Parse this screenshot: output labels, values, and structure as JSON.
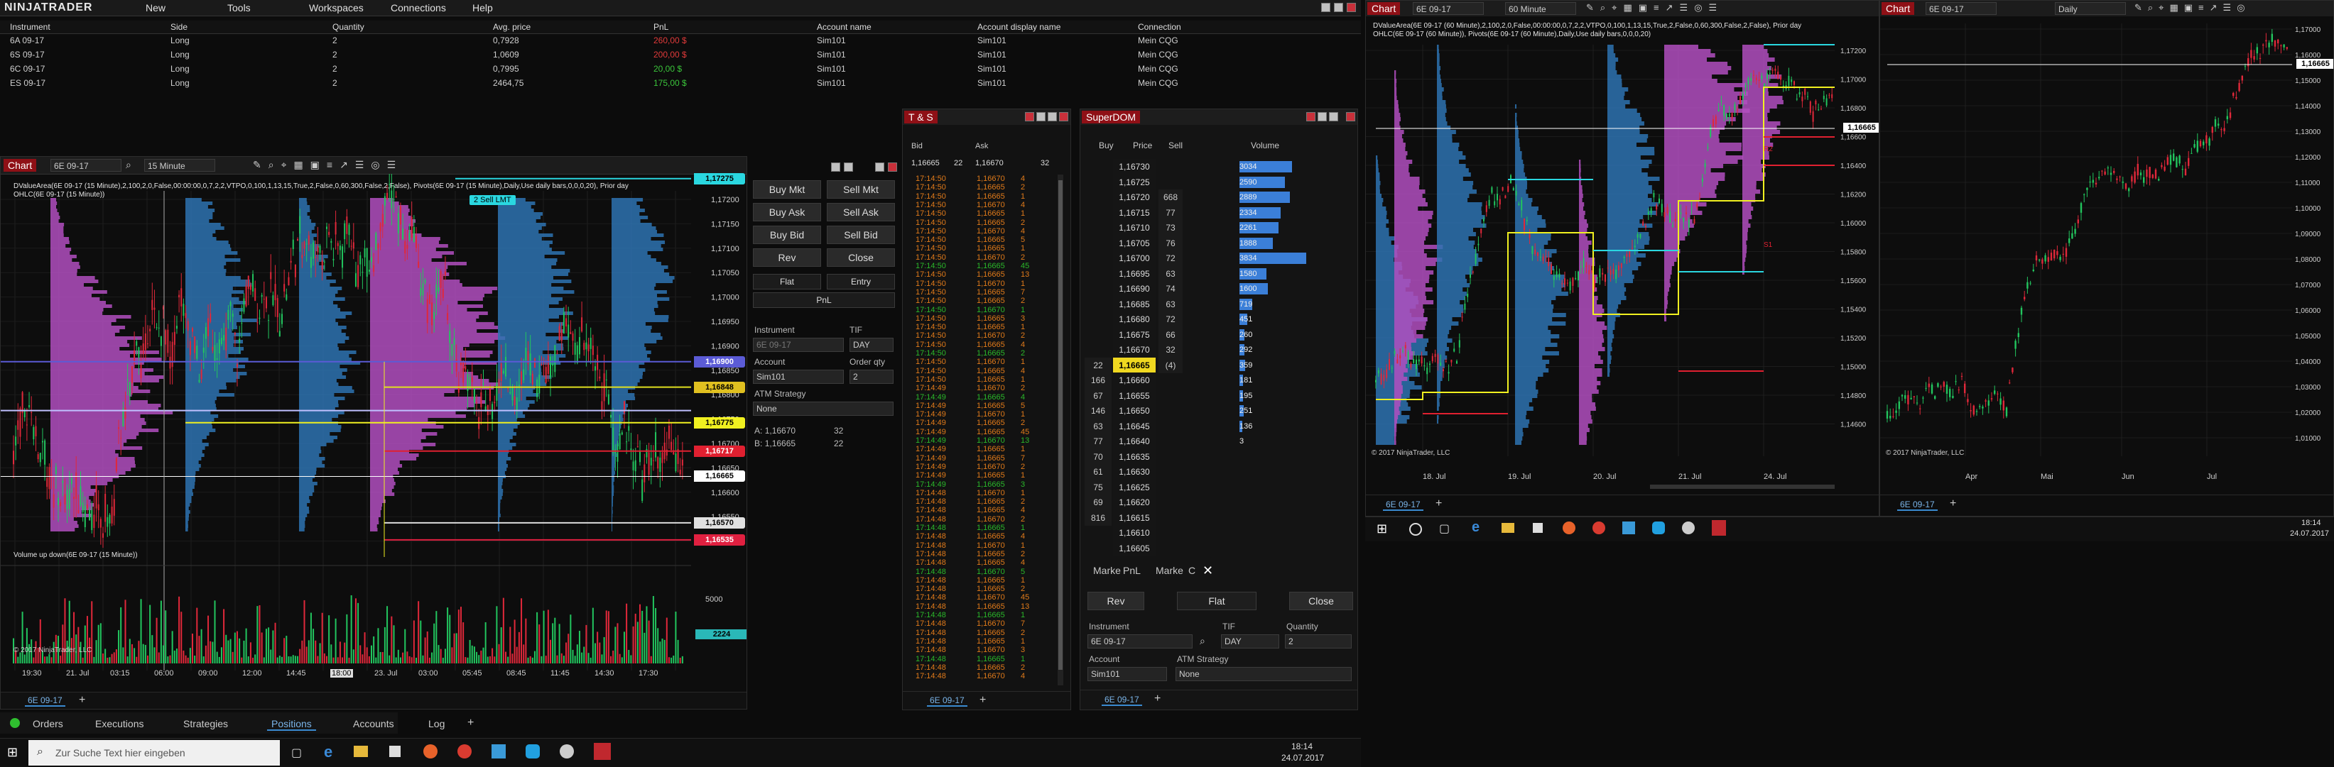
{
  "control_center": {
    "brand": "NINJATRADER",
    "menu": [
      "New",
      "Tools",
      "Workspaces",
      "Connections",
      "Help"
    ],
    "positions_headers": [
      "Instrument",
      "Side",
      "Quantity",
      "Avg. price",
      "PnL",
      "Account name",
      "Account display name",
      "Connection"
    ],
    "positions_rows": [
      {
        "instrument": "6A 09-17",
        "side": "Long",
        "qty": "2",
        "avg": "0,7928",
        "pnl": "260,00 $",
        "pnl_color": "#e03a3a",
        "account": "Sim101",
        "display": "Sim101",
        "conn": "Mein CQG"
      },
      {
        "instrument": "6S 09-17",
        "side": "Long",
        "qty": "2",
        "avg": "1,0609",
        "pnl": "200,00 $",
        "pnl_color": "#e03a3a",
        "account": "Sim101",
        "display": "Sim101",
        "conn": "Mein CQG"
      },
      {
        "instrument": "6C 09-17",
        "side": "Long",
        "qty": "2",
        "avg": "0,7995",
        "pnl": "20,00 $",
        "pnl_color": "#3ac43a",
        "account": "Sim101",
        "display": "Sim101",
        "conn": "Mein CQG"
      },
      {
        "instrument": "ES 09-17",
        "side": "Long",
        "qty": "2",
        "avg": "2464,75",
        "pnl": "175,00 $",
        "pnl_color": "#3ac43a",
        "account": "Sim101",
        "display": "Sim101",
        "conn": "Mein CQG"
      }
    ],
    "bottom_tabs": [
      "Orders",
      "Executions",
      "Strategies",
      "Positions",
      "Accounts",
      "Log"
    ],
    "active_tab": "Positions"
  },
  "chart1": {
    "title": "Chart",
    "instrument": "6E 09-17",
    "interval": "15 Minute",
    "indicator_line1": "DValueArea(6E 09-17 (15 Minute),2,100,2,0,False,00:00:00,0,7,2,2,VTPO,0,100,1,13,15,True,2,False,0,60,300,False,2,False), Pivots(6E 09-17 (15 Minute),Daily,Use daily bars,0,0,0,20), Prior day",
    "indicator_line2": "OHLC(6E 09-17 (15 Minute))",
    "sell_lmt_label": "2  Sell LMT",
    "price_labels": [
      "1,17200",
      "1,17150",
      "1,17100",
      "1,17050",
      "1,17000",
      "1,16950",
      "1,16900",
      "1,16850",
      "1,16800",
      "1,16750",
      "1,16700",
      "1,16650",
      "1,16600",
      "1,16550",
      "1,16500"
    ],
    "price_boxes": [
      {
        "text": "1,17275",
        "bg": "#2ad7e0",
        "fg": "#000"
      },
      {
        "text": "1,16900",
        "bg": "#5b5bd6",
        "fg": "#fff"
      },
      {
        "text": "1,16848",
        "bg": "#e0c020",
        "fg": "#000"
      },
      {
        "text": "1,16775",
        "bg": "#f0f020",
        "fg": "#000"
      },
      {
        "text": "1,16717",
        "bg": "#e02030",
        "fg": "#fff"
      },
      {
        "text": "1,16665",
        "bg": "#ffffff",
        "fg": "#000"
      },
      {
        "text": "1,16570",
        "bg": "#e0e0e0",
        "fg": "#000"
      },
      {
        "text": "1,16535",
        "bg": "#e02040",
        "fg": "#fff"
      }
    ],
    "volume_title": "Volume up down(6E 09-17 (15 Minute))",
    "volume_box": "2224",
    "volume_label": "5000",
    "copyright": "© 2017 NinjaTrader, LLC",
    "time_labels": [
      "19:30",
      "21. Jul",
      "03:15",
      "06:00",
      "09:00",
      "12:00",
      "14:45",
      "18:00",
      "23. Jul",
      "03:00",
      "05:45",
      "08:45",
      "11:45",
      "14:30",
      "17:30"
    ],
    "bottom_tab": "6E 09-17",
    "chart_trader": {
      "buttons": [
        "Buy Mkt",
        "Sell Mkt",
        "Buy Ask",
        "Sell Ask",
        "Buy Bid",
        "Sell Bid",
        "Rev",
        "Close",
        "Flat",
        "Entry",
        "PnL"
      ],
      "instrument_label": "Instrument",
      "instrument_value": "6E 09-17",
      "tif_label": "TIF",
      "tif_value": "DAY",
      "account_label": "Account",
      "account_value": "Sim101",
      "qty_label": "Order qty",
      "qty_value": "2",
      "atm_label": "ATM Strategy",
      "atm_value": "None",
      "ask_line_label": "A:",
      "ask_line_price": "1,16670",
      "ask_line_size": "32",
      "bid_line_label": "B:",
      "bid_line_price": "1,16665",
      "bid_line_size": "22"
    }
  },
  "ts": {
    "title": "T & S",
    "header_bid": "Bid",
    "header_ask": "Ask",
    "bid": "1,16665",
    "bid_size": "22",
    "ask": "1,16670",
    "ask_size": "32",
    "bottom_tab": "6E 09-17"
  },
  "superdom": {
    "title": "SuperDOM",
    "headers": [
      "Buy",
      "Price",
      "Sell",
      "Volume"
    ],
    "rows": [
      {
        "buy": "",
        "price": "1,16730",
        "sell": "",
        "vol": "3034",
        "w": 0.62
      },
      {
        "buy": "",
        "price": "1,16725",
        "sell": "",
        "vol": "2590",
        "w": 0.53
      },
      {
        "buy": "",
        "price": "1,16720",
        "sell": "668",
        "vol": "2889",
        "w": 0.59
      },
      {
        "buy": "",
        "price": "1,16715",
        "sell": "77",
        "vol": "2334",
        "w": 0.48
      },
      {
        "buy": "",
        "price": "1,16710",
        "sell": "73",
        "vol": "2261",
        "w": 0.46
      },
      {
        "buy": "",
        "price": "1,16705",
        "sell": "76",
        "vol": "1888",
        "w": 0.39
      },
      {
        "buy": "",
        "price": "1,16700",
        "sell": "72",
        "vol": "3834",
        "w": 0.78
      },
      {
        "buy": "",
        "price": "1,16695",
        "sell": "63",
        "vol": "1580",
        "w": 0.32
      },
      {
        "buy": "",
        "price": "1,16690",
        "sell": "74",
        "vol": "1600",
        "w": 0.33
      },
      {
        "buy": "",
        "price": "1,16685",
        "sell": "63",
        "vol": "719",
        "w": 0.15
      },
      {
        "buy": "",
        "price": "1,16680",
        "sell": "72",
        "vol": "451",
        "w": 0.09
      },
      {
        "buy": "",
        "price": "1,16675",
        "sell": "66",
        "vol": "260",
        "w": 0.06
      },
      {
        "buy": "",
        "price": "1,16670",
        "sell": "32",
        "vol": "292",
        "w": 0.06
      },
      {
        "buy": "22",
        "price": "1,16665",
        "sell": "(4)",
        "vol": "359",
        "w": 0.07
      },
      {
        "buy": "166",
        "price": "1,16660",
        "sell": "",
        "vol": "181",
        "w": 0.04
      },
      {
        "buy": "67",
        "price": "1,16655",
        "sell": "",
        "vol": "195",
        "w": 0.04
      },
      {
        "buy": "146",
        "price": "1,16650",
        "sell": "",
        "vol": "251",
        "w": 0.05
      },
      {
        "buy": "63",
        "price": "1,16645",
        "sell": "",
        "vol": "136",
        "w": 0.03
      },
      {
        "buy": "77",
        "price": "1,16640",
        "sell": "",
        "vol": "3",
        "w": 0.0
      },
      {
        "buy": "70",
        "price": "1,16635",
        "sell": "",
        "vol": "",
        "w": 0
      },
      {
        "buy": "61",
        "price": "1,16630",
        "sell": "",
        "vol": "",
        "w": 0
      },
      {
        "buy": "75",
        "price": "1,16625",
        "sell": "",
        "vol": "",
        "w": 0
      },
      {
        "buy": "69",
        "price": "1,16620",
        "sell": "",
        "vol": "",
        "w": 0
      },
      {
        "buy": "816",
        "price": "1,16615",
        "sell": "",
        "vol": "",
        "w": 0
      },
      {
        "buy": "",
        "price": "1,16610",
        "sell": "",
        "vol": "",
        "w": 0
      },
      {
        "buy": "",
        "price": "1,16605",
        "sell": "",
        "vol": "",
        "w": 0
      }
    ],
    "footer": [
      "Marke",
      "PnL",
      "Marke",
      "C"
    ],
    "rev": "Rev",
    "flat": "Flat",
    "close": "Close",
    "instrument_label": "Instrument",
    "instrument_value": "6E 09-17",
    "tif_label": "TIF",
    "tif_value": "DAY",
    "qty_label": "Quantity",
    "qty_value": "2",
    "account_label": "Account",
    "account_value": "Sim101",
    "atm_label": "ATM Strategy",
    "atm_value": "None",
    "bottom_tab": "6E 09-17"
  },
  "chart2": {
    "title": "Chart",
    "instrument": "6E 09-17",
    "interval": "60 Minute",
    "indicator_line1": "DValueArea(6E 09-17 (60 Minute),2,100,2,0,False,00:00:00,0,7,2,2,VTPO,0,100,1,13,15,True,2,False,0,60,300,False,2,False), Prior day",
    "indicator_line2": "OHLC(6E 09-17 (60 Minute)), Pivots(6E 09-17 (60 Minute),Daily,Use daily bars,0,0,0,20)",
    "price_labels": [
      "1,17200",
      "1,17000",
      "1,16800",
      "1,16600",
      "1,16400",
      "1,16200",
      "1,16000",
      "1,15800",
      "1,15600",
      "1,15400",
      "1,15200",
      "1,15000",
      "1,14800",
      "1,14600"
    ],
    "price_box": "1,16665",
    "annotation_r2": "R2",
    "annotation_s1": "S1",
    "date_labels": [
      "18. Jul",
      "19. Jul",
      "20. Jul",
      "21. Jul",
      "24. Jul"
    ],
    "copyright": "© 2017 NinjaTrader, LLC",
    "bottom_tab": "6E 09-17"
  },
  "chart3": {
    "title": "Chart",
    "instrument": "6E 09-17",
    "interval": "Daily",
    "price_labels": [
      "1,17000",
      "1,16000",
      "1,15000",
      "1,14000",
      "1,13000",
      "1,12000",
      "1,11000",
      "1,10000",
      "1,09000",
      "1,08000",
      "1,07000",
      "1,06000",
      "1,05000",
      "1,04000",
      "1,03000",
      "1,02000",
      "1,01000"
    ],
    "price_box": "1,16665",
    "date_labels": [
      "Apr",
      "Mai",
      "Jun",
      "Jul"
    ],
    "copyright": "© 2017 NinjaTrader, LLC",
    "bottom_tab": "6E 09-17"
  },
  "taskbar_left": {
    "search_placeholder": "Zur Suche Text hier eingeben",
    "time": "18:14",
    "date": "24.07.2017"
  },
  "taskbar_right": {
    "time": "18:14",
    "date": "24.07.2017"
  }
}
